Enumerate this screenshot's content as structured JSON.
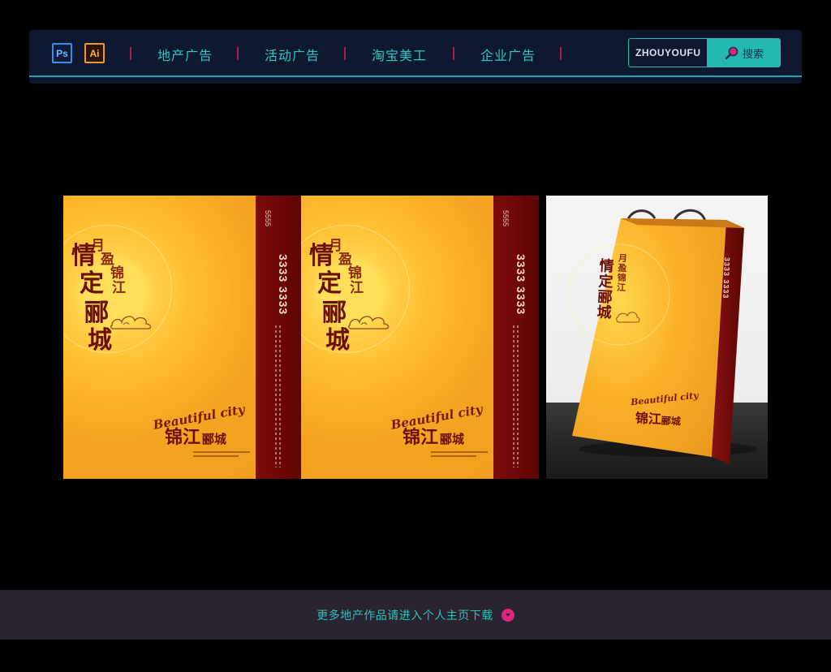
{
  "toolbar": {
    "apps": [
      {
        "label": "Ps",
        "color": "#3a8ee8"
      },
      {
        "label": "Ai",
        "color": "#e89a2a"
      }
    ],
    "nav": [
      {
        "label": "地产广告"
      },
      {
        "label": "活动广告"
      },
      {
        "label": "淘宝美工"
      },
      {
        "label": "企业广告"
      }
    ],
    "search": {
      "value": "ZHOUYOUFU",
      "button_label": "搜索",
      "button_icon": "search-icon"
    },
    "accent_color": "#25b8b2",
    "separator_color": "#b3184f"
  },
  "design": {
    "slogan_small": [
      "月",
      "盈",
      "锦",
      "江"
    ],
    "slogan_big": [
      "情",
      "定",
      "郦",
      "城"
    ],
    "english_tagline": "Beautiful city",
    "brand_name": "锦江",
    "brand_suffix": "郦城",
    "phone_number": "3333 3333",
    "phone_prefix": "5555",
    "colors": {
      "gold": "#fbb12a",
      "maroon": "#6d0707"
    }
  },
  "footer": {
    "text": "更多地产作品请进入个人主页下载",
    "icon": "chevron-down-icon",
    "icon_color": "#e0257f"
  }
}
